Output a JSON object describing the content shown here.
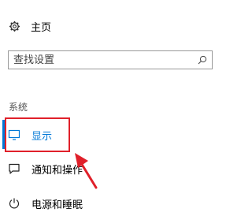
{
  "home": {
    "icon": "gear-icon",
    "label": "主页"
  },
  "search": {
    "placeholder": "查找设置",
    "icon": "search-icon"
  },
  "section": {
    "title": "系统"
  },
  "nav": {
    "items": [
      {
        "label": "显示",
        "icon": "monitor-icon",
        "active": true
      },
      {
        "label": "通知和操作",
        "icon": "notification-icon",
        "active": false
      },
      {
        "label": "电源和睡眠",
        "icon": "power-icon",
        "active": false
      }
    ]
  },
  "colors": {
    "accent": "#0078d7",
    "annotation": "#e0202a"
  }
}
